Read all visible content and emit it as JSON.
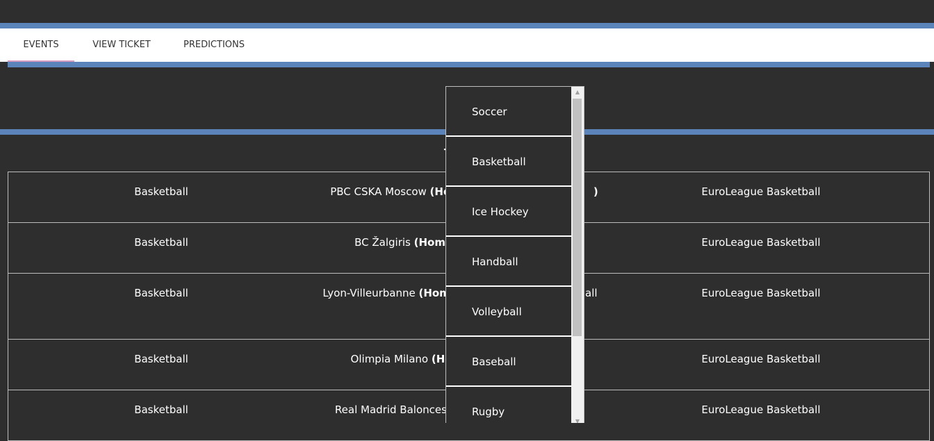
{
  "nav": {
    "tabs": [
      {
        "label": "EVENTS",
        "active": true
      },
      {
        "label": "VIEW TICKET",
        "active": false
      },
      {
        "label": "PREDICTIONS",
        "active": false
      }
    ]
  },
  "section": {
    "title": "Tomo"
  },
  "events": [
    {
      "sport": "Basketball",
      "team": "PBC CSKA Moscow ",
      "home_tag": "(Hom",
      "away_suffix": ")",
      "league": "EuroLeague Basketball"
    },
    {
      "sport": "Basketball",
      "team": "BC Žalgiris ",
      "home_tag": "(Home)",
      "away_suffix": "",
      "league": "EuroLeague Basketball"
    },
    {
      "sport": "Basketball",
      "team": "Lyon-Villeurbanne ",
      "home_tag": "(Home",
      "away_suffix": "all",
      "league": "EuroLeague Basketball"
    },
    {
      "sport": "Basketball",
      "team": "Olimpia Milano ",
      "home_tag": "(Hor",
      "away_suffix": "",
      "league": "EuroLeague Basketball"
    },
    {
      "sport": "Basketball",
      "team": "Real Madrid Baloncesto",
      "home_tag": "",
      "away_suffix": "",
      "league": "EuroLeague Basketball"
    }
  ],
  "sport_dropdown": {
    "options": [
      "Soccer",
      "Basketball",
      "Ice Hockey",
      "Handball",
      "Volleyball",
      "Baseball",
      "Rugby"
    ]
  },
  "colors": {
    "background": "#2e2e2e",
    "accent_blue": "#5b84bb",
    "active_tab_underline": "#d89cc0",
    "nav_background": "#ffffff"
  }
}
